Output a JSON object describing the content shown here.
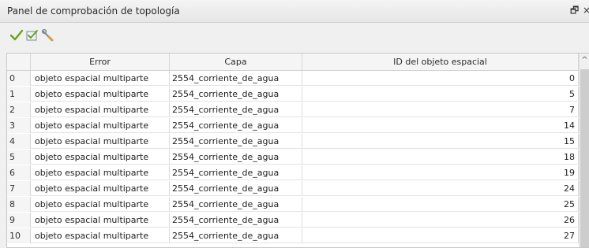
{
  "panel": {
    "title": "Panel de comprobación de topología",
    "float_glyph": "🗗",
    "close_glyph": "×"
  },
  "toolbar": {
    "buttons": [
      {
        "name": "validate-all",
        "icon": "checkmark-icon"
      },
      {
        "name": "validate-extent",
        "icon": "check-extent-icon"
      },
      {
        "name": "configure-rules",
        "icon": "wrench-icon"
      }
    ]
  },
  "table": {
    "columns": [
      "",
      "Error",
      "Capa",
      "ID del objeto espacial"
    ],
    "rows": [
      {
        "index": "0",
        "error": "objeto espacial multiparte",
        "capa": "2554_corriente_de_agua",
        "id": "0"
      },
      {
        "index": "1",
        "error": "objeto espacial multiparte",
        "capa": "2554_corriente_de_agua",
        "id": "5"
      },
      {
        "index": "2",
        "error": "objeto espacial multiparte",
        "capa": "2554_corriente_de_agua",
        "id": "7"
      },
      {
        "index": "3",
        "error": "objeto espacial multiparte",
        "capa": "2554_corriente_de_agua",
        "id": "14"
      },
      {
        "index": "4",
        "error": "objeto espacial multiparte",
        "capa": "2554_corriente_de_agua",
        "id": "15"
      },
      {
        "index": "5",
        "error": "objeto espacial multiparte",
        "capa": "2554_corriente_de_agua",
        "id": "18"
      },
      {
        "index": "6",
        "error": "objeto espacial multiparte",
        "capa": "2554_corriente_de_agua",
        "id": "19"
      },
      {
        "index": "7",
        "error": "objeto espacial multiparte",
        "capa": "2554_corriente_de_agua",
        "id": "24"
      },
      {
        "index": "8",
        "error": "objeto espacial multiparte",
        "capa": "2554_corriente_de_agua",
        "id": "25"
      },
      {
        "index": "9",
        "error": "objeto espacial multiparte",
        "capa": "2554_corriente_de_agua",
        "id": "26"
      },
      {
        "index": "10",
        "error": "objeto espacial multiparte",
        "capa": "2554_corriente_de_agua",
        "id": "27"
      }
    ]
  },
  "scrollbar": {
    "up_glyph": "^"
  }
}
